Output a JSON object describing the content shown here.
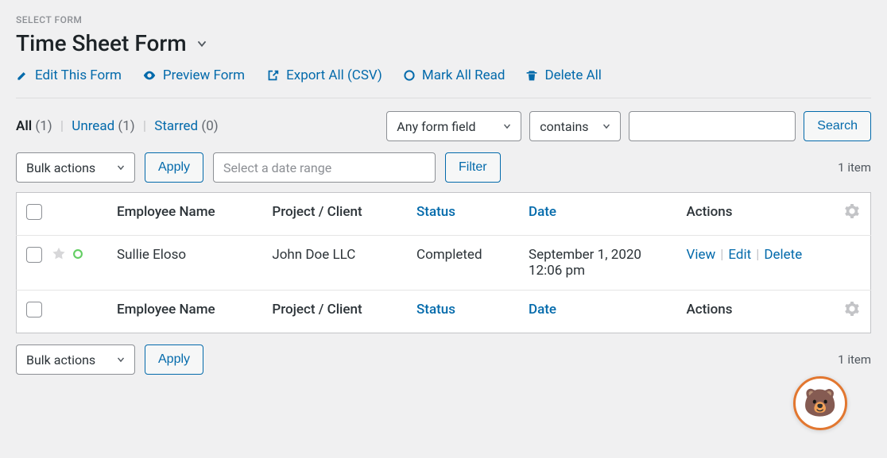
{
  "header": {
    "select_form_label": "SELECT FORM",
    "form_title": "Time Sheet Form"
  },
  "toolbar": {
    "edit": "Edit This Form",
    "preview": "Preview Form",
    "export": "Export All (CSV)",
    "mark_read": "Mark All Read",
    "delete_all": "Delete All"
  },
  "status_filters": {
    "all_label": "All",
    "all_count": "(1)",
    "unread_label": "Unread",
    "unread_count": "(1)",
    "starred_label": "Starred",
    "starred_count": "(0)"
  },
  "search": {
    "field_select": "Any form field",
    "operator_select": "contains",
    "input_value": "",
    "button": "Search"
  },
  "bulk": {
    "select_label": "Bulk actions",
    "apply": "Apply",
    "date_placeholder": "Select a date range",
    "filter": "Filter",
    "item_count": "1 item"
  },
  "table": {
    "columns": {
      "employee": "Employee Name",
      "project": "Project / Client",
      "status": "Status",
      "date": "Date",
      "actions": "Actions"
    },
    "rows": [
      {
        "employee": "Sullie Eloso",
        "project": "John Doe LLC",
        "status": "Completed",
        "date": "September 1, 2020 12:06 pm"
      }
    ],
    "row_actions": {
      "view": "View",
      "edit": "Edit",
      "delete": "Delete"
    }
  }
}
